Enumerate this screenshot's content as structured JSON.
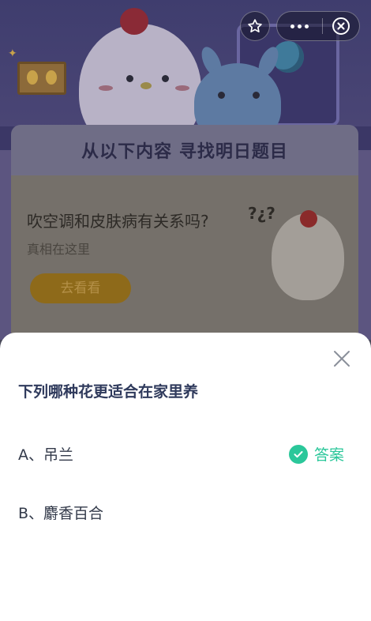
{
  "capsule": {
    "favorite_icon": "star-icon",
    "more_icon": "more-dots-icon",
    "close_icon": "close-circle-icon"
  },
  "background": {
    "banner_title": "从以下内容  寻找明日题目",
    "card": {
      "question": "吹空调和皮肤病有关系吗?",
      "subtitle": "真相在这里",
      "button_label": "去看看",
      "marks": "?¿?"
    }
  },
  "sheet": {
    "close_icon": "close-icon",
    "question": "下列哪种花更适合在家里养",
    "options": [
      {
        "label": "A、吊兰",
        "is_answer": true
      },
      {
        "label": "B、麝香百合",
        "is_answer": false
      }
    ],
    "answer_label": "答案",
    "accent_color": "#2bc79a"
  }
}
